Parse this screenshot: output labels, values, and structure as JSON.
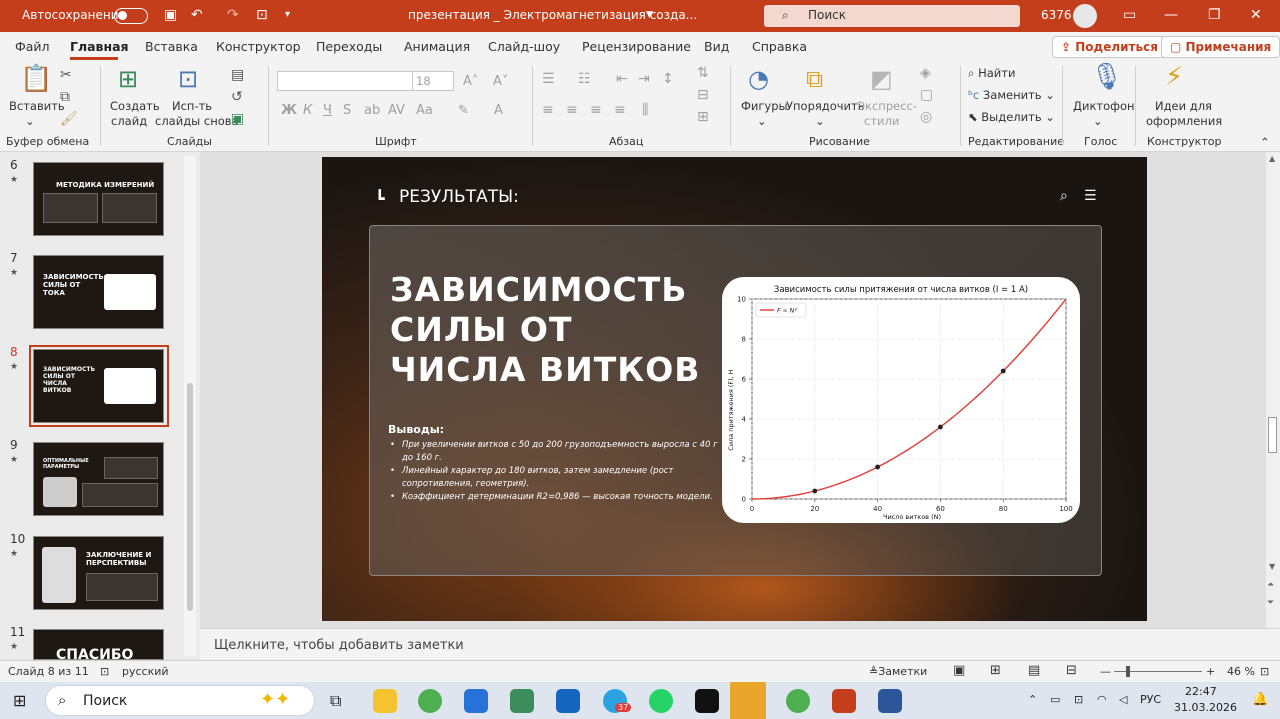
{
  "titlebar": {
    "autosave": "Автосохранение",
    "filename": "презентация _ Электромагнетизация созда...",
    "search_placeholder": "Поиск",
    "user_id": "6376"
  },
  "tabs": [
    "Файл",
    "Главная",
    "Вставка",
    "Конструктор",
    "Переходы",
    "Анимация",
    "Слайд-шоу",
    "Рецензирование",
    "Вид",
    "Справка"
  ],
  "share": "Поделиться",
  "comments": "Примечания",
  "ribbon": {
    "paste": "Вставить",
    "clipboard_group": "Буфер обмена",
    "new_slide_1": "Создать",
    "new_slide_2": "слайд",
    "reuse_1": "Исп-ть",
    "reuse_2": "слайды снова",
    "slides_group": "Слайды",
    "font_size": "18",
    "font_group": "Шрифт",
    "para_group": "Абзац",
    "shapes": "Фигуры",
    "arrange": "Упорядочить",
    "quick_styles_1": "Экспресс-",
    "quick_styles_2": "стили",
    "drawing_group": "Рисование",
    "find": "Найти",
    "replace": "Заменить",
    "select": "Выделить",
    "editing_group": "Редактирование",
    "dictate": "Диктофон",
    "voice_group": "Голос",
    "designer_1": "Идеи для",
    "designer_2": "оформления",
    "designer_group": "Конструктор"
  },
  "slides_panel": [
    {
      "num": "6",
      "text": "МЕТОДИКА ИЗМЕРЕНИЙ"
    },
    {
      "num": "7",
      "text": "ЗАВИСИМОСТЬ СИЛЫ ОТ ТОКА"
    },
    {
      "num": "8",
      "text": "ЗАВИСИМОСТЬ СИЛЫ ОТ ЧИСЛА ВИТКОВ"
    },
    {
      "num": "9",
      "text": "ОПТИМАЛЬНЫЕ ПАРАМЕТРЫ"
    },
    {
      "num": "10",
      "text": "ЗАКЛЮЧЕНИЕ И ПЕРСПЕКТИВЫ"
    },
    {
      "num": "11",
      "text": "СПАСИБО"
    }
  ],
  "slide": {
    "header": "РЕЗУЛЬТАТЫ:",
    "headline": "ЗАВИСИМОСТЬ СИЛЫ ОТ ЧИСЛА ВИТКОВ",
    "conclusions_title": "Выводы:",
    "conclusions": [
      "При увеличении витков с 50 до 200 грузоподъемность выросла с 40 г до 160 г.",
      "Линейный характер до 180 витков, затем замедление (рост сопротивления, геометрия).",
      "Коэффициент детерминации R2=0,986 — высокая точность модели."
    ]
  },
  "chart_data": {
    "type": "line",
    "title": "Зависимость силы притяжения от числа витков (I = 1 A)",
    "xlabel": "Число витков (N)",
    "ylabel": "Сила притяжения (F), Н",
    "xlim": [
      0,
      100
    ],
    "ylim": [
      0,
      10
    ],
    "xticks": [
      0,
      20,
      40,
      60,
      80,
      100
    ],
    "yticks": [
      0,
      2,
      4,
      6,
      8,
      10
    ],
    "grid": true,
    "legend": "top-left",
    "series": [
      {
        "name": "F ∝ N²",
        "color": "#e53935",
        "x": [
          0,
          10,
          20,
          30,
          40,
          50,
          60,
          70,
          80,
          90,
          100
        ],
        "y": [
          0,
          0.1,
          0.4,
          0.9,
          1.6,
          2.5,
          3.6,
          4.9,
          6.4,
          8.1,
          10
        ]
      }
    ],
    "markers": {
      "x": [
        20,
        40,
        60,
        80
      ],
      "y": [
        0.4,
        1.6,
        3.6,
        6.4
      ]
    }
  },
  "notes": "Щелкните, чтобы добавить заметки",
  "status": {
    "slide_of": "Слайд 8 из 11",
    "language": "русский",
    "notes_btn": "Заметки",
    "zoom": "46 %"
  },
  "taskbar": {
    "search": "Поиск",
    "lang": "РУС",
    "time": "22:47",
    "date": "31.03.2026",
    "badge": "37"
  }
}
